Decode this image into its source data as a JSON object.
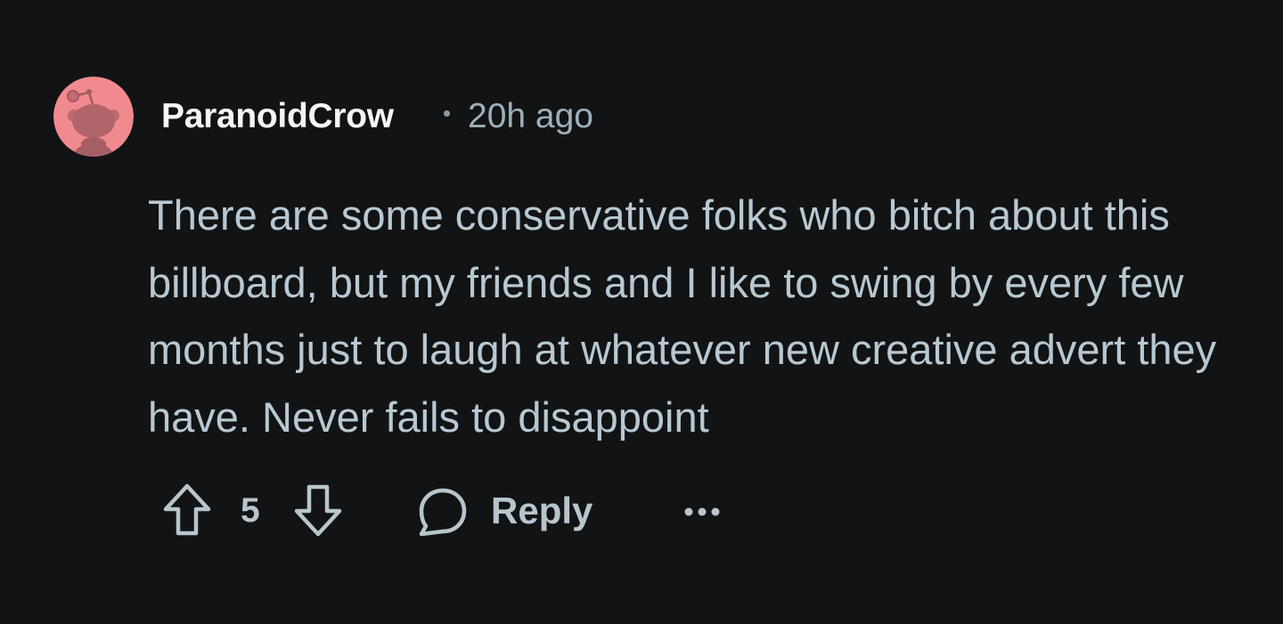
{
  "comment": {
    "username": "ParanoidCrow",
    "timestamp": "20h ago",
    "body": "There are some conservative folks who bitch about this billboard, but my friends and I like to swing by every few months just to laugh at whatever new creative advert they have. Never fails to disappoint",
    "score": "5",
    "reply_label": "Reply"
  },
  "icons": {
    "avatar": "snoo-avatar-icon",
    "upvote": "upvote-arrow-icon",
    "downvote": "downvote-arrow-icon",
    "reply": "speech-bubble-icon",
    "more": "more-dots-icon"
  },
  "colors": {
    "background": "#111315",
    "avatar_bg": "#f08a8f",
    "username": "#f3f5f6",
    "text": "#b8c8d2",
    "muted": "#9fb0ba"
  }
}
